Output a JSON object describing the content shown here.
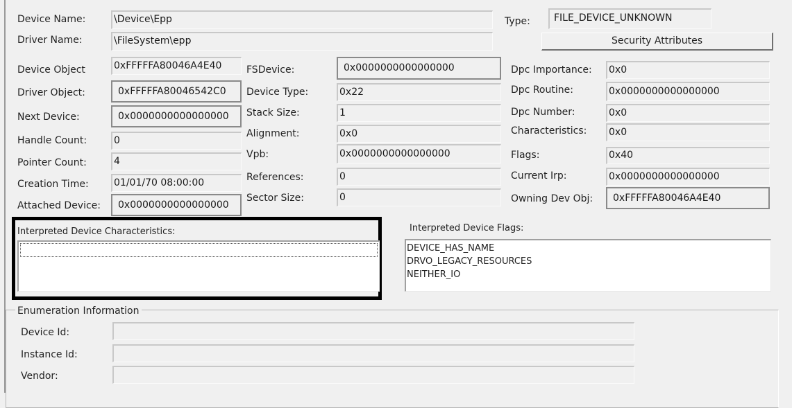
{
  "header": {
    "device_name_label": "Device Name:",
    "device_name": "\\Device\\Epp",
    "driver_name_label": "Driver Name:",
    "driver_name": "\\FileSystem\\epp",
    "type_label": "Type:",
    "type": "FILE_DEVICE_UNKNOWN",
    "security_button": "Security Attributes"
  },
  "left_fields": [
    {
      "label": "Device Object",
      "value": "0xFFFFFA80046A4E40"
    },
    {
      "label": "Driver Object:",
      "value": "0xFFFFFA80046542C0"
    },
    {
      "label": "Next Device:",
      "value": "0x0000000000000000"
    },
    {
      "label": "Handle Count:",
      "value": "0"
    },
    {
      "label": "Pointer Count:",
      "value": "4"
    },
    {
      "label": "Creation Time:",
      "value": "01/01/70 08:00:00"
    },
    {
      "label": "Attached Device:",
      "value": "0x0000000000000000"
    }
  ],
  "middle_fields": [
    {
      "label": "FSDevice:",
      "value": "0x0000000000000000"
    },
    {
      "label": "Device Type:",
      "value": "0x22"
    },
    {
      "label": "Stack Size:",
      "value": "1"
    },
    {
      "label": "Alignment:",
      "value": "0x0"
    },
    {
      "label": "Vpb:",
      "value": "0x0000000000000000"
    },
    {
      "label": "References:",
      "value": "0"
    },
    {
      "label": "Sector Size:",
      "value": "0"
    }
  ],
  "right_fields": [
    {
      "label": "Dpc Importance:",
      "value": "0x0"
    },
    {
      "label": "Dpc Routine:",
      "value": "0x0000000000000000"
    },
    {
      "label": "Dpc Number:",
      "value": "0x0"
    },
    {
      "label": "Characteristics:",
      "value": "0x0"
    },
    {
      "label": "Flags:",
      "value": "0x40"
    },
    {
      "label": "Current Irp:",
      "value": "0x0000000000000000"
    },
    {
      "label": "Owning Dev Obj:",
      "value": "0xFFFFFA80046A4E40"
    }
  ],
  "characteristics": {
    "label": "Interpreted Device Characteristics:",
    "items": []
  },
  "flags": {
    "label": "Interpreted Device Flags:",
    "items": [
      "DEVICE_HAS_NAME",
      "DRVO_LEGACY_RESOURCES",
      "NEITHER_IO"
    ]
  },
  "enumeration": {
    "title": "Enumeration Information",
    "fields": [
      {
        "label": "Device Id:",
        "value": ""
      },
      {
        "label": "Instance Id:",
        "value": ""
      },
      {
        "label": "Vendor:",
        "value": ""
      }
    ]
  }
}
